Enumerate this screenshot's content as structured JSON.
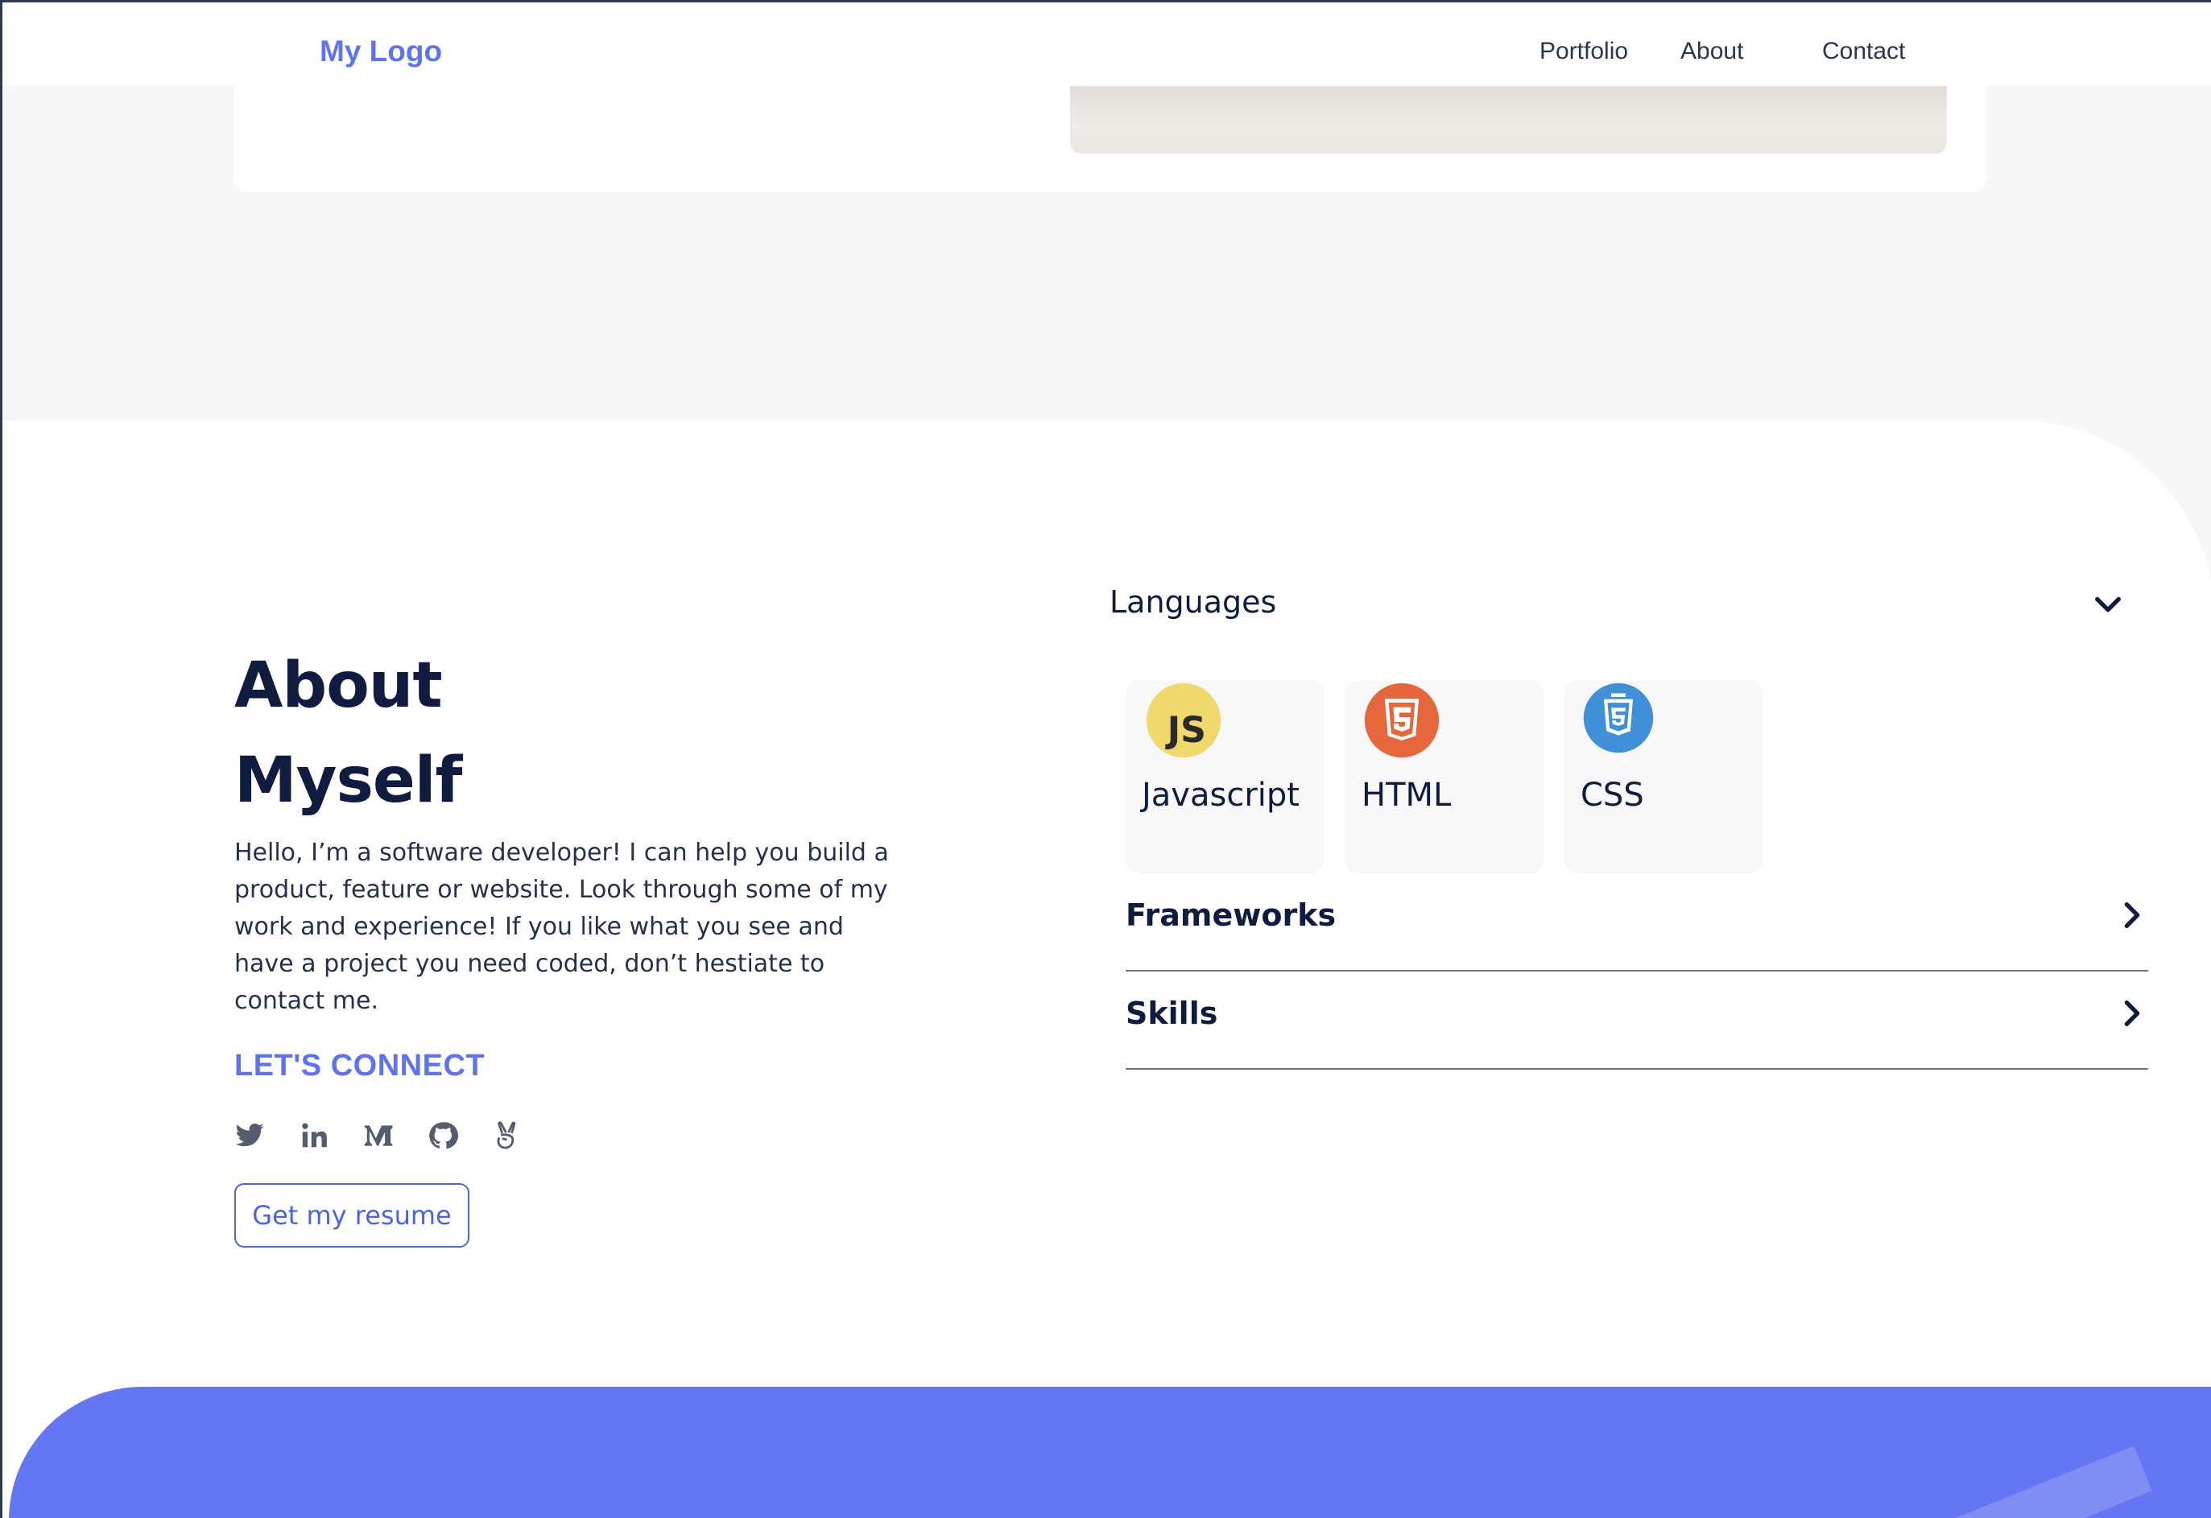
{
  "header": {
    "logo": "My Logo",
    "nav": [
      "Portfolio",
      "About",
      "Contact"
    ]
  },
  "about": {
    "title_line1": "About",
    "title_line2": "Myself",
    "body": "Hello, I’m a software developer! I can help you build a product, feature or website. Look through some of my work and experience! If you like what you see and have a project you need coded, don’t hestiate to contact me.",
    "connect_label": "LET'S CONNECT",
    "socials": [
      "twitter-icon",
      "linkedin-icon",
      "medium-icon",
      "github-icon",
      "angellist-icon"
    ],
    "resume_button": "Get my resume"
  },
  "accordion": {
    "languages": {
      "label": "Languages",
      "items": [
        {
          "name": "Javascript",
          "icon": "javascript-icon",
          "color": "#efd86c"
        },
        {
          "name": "HTML",
          "icon": "html5-icon",
          "color": "#e4663a"
        },
        {
          "name": "CSS",
          "icon": "css3-icon",
          "color": "#3f8fd9"
        }
      ]
    },
    "frameworks": {
      "label": "Frameworks"
    },
    "skills": {
      "label": "Skills"
    }
  },
  "colors": {
    "accent": "#5f73f0",
    "heading": "#0f1c3f",
    "footer": "#6476f2"
  }
}
